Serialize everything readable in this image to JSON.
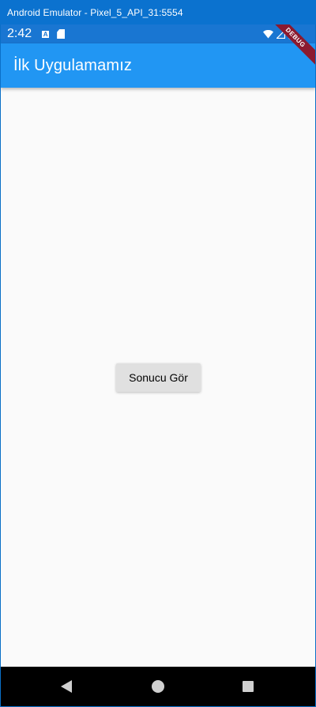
{
  "window": {
    "title": "Android Emulator - Pixel_5_API_31:5554"
  },
  "status_bar": {
    "time": "2:42",
    "notification_a": "A",
    "icons": [
      "a-notification-icon",
      "sd-card-icon",
      "wifi-icon",
      "signal-icon",
      "battery-icon"
    ]
  },
  "app_bar": {
    "title": "İlk Uygulamamız",
    "color": "#2196f3"
  },
  "debug_banner": {
    "label": "DEBUG"
  },
  "main": {
    "button_label": "Sonucu Gör"
  },
  "nav_bar": {
    "icons": [
      "back-icon",
      "home-icon",
      "recents-icon"
    ]
  }
}
